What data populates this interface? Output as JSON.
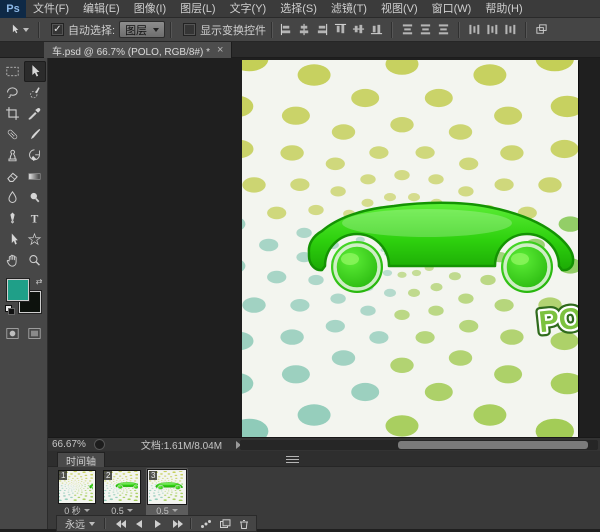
{
  "menu_bar": {
    "logo_text": "Ps",
    "items": [
      "文件(F)",
      "编辑(E)",
      "图像(I)",
      "图层(L)",
      "文字(Y)",
      "选择(S)",
      "滤镜(T)",
      "视图(V)",
      "窗口(W)",
      "帮助(H)"
    ]
  },
  "options_bar": {
    "auto_select_label": "自动选择:",
    "auto_select_value": "图层",
    "show_transform_label": "显示变换控件",
    "checkmark_glyph": "✓",
    "align_buttons": [
      "align-left-edges",
      "align-horizontal-centers",
      "align-right-edges",
      "align-top-edges",
      "align-vertical-centers",
      "align-bottom-edges",
      "distribute-top-edges",
      "distribute-vertical-centers",
      "distribute-bottom-edges",
      "distribute-left-edges",
      "distribute-horizontal-centers",
      "distribute-right-edges",
      "auto-align-layers"
    ]
  },
  "document_tab": {
    "title": "车.psd @ 66.7% (POLO, RGB/8#) *",
    "close_glyph": "×"
  },
  "tools": {
    "selected": "move-tool",
    "items": [
      "rectangular-marquee-tool",
      "move-tool",
      "lasso-tool",
      "quick-selection-tool",
      "crop-tool",
      "eyedropper-tool",
      "spot-healing-brush-tool",
      "brush-tool",
      "clone-stamp-tool",
      "history-brush-tool",
      "eraser-tool",
      "gradient-tool",
      "blur-tool",
      "dodge-tool",
      "pen-tool",
      "type-tool",
      "path-selection-tool",
      "custom-shape-tool",
      "hand-tool",
      "zoom-tool"
    ],
    "bottom_items": [
      "quick-mask-button",
      "screen-mode-button"
    ]
  },
  "color_swatches": {
    "foreground": "#1f9f88",
    "background": "#0d120d"
  },
  "canvas": {
    "po_text": "PO",
    "colors": {
      "paper": "#f3f5ef",
      "dot_olive": "#c3ce55",
      "dot_green": "#7cc548",
      "dot_green2": "#a2cb55",
      "dot_teal": "#8ecab8",
      "car_light": "#5dee37",
      "car_main": "#2ed10e",
      "car_dark": "#1cab05",
      "car_stroke": "#149303",
      "po_fill": "#7cc23f"
    }
  },
  "status_bar": {
    "zoom_level": "66.67%",
    "doc_info": "文档:1.61M/8.04M"
  },
  "timeline": {
    "tab_label": "时间轴",
    "loop_label": "永远",
    "selected_frame_index": 2,
    "frames": [
      {
        "number": "1",
        "duration": "0 秒"
      },
      {
        "number": "2",
        "duration": "0.5"
      },
      {
        "number": "3",
        "duration": "0.5"
      }
    ],
    "buttons": [
      "first-frame-button",
      "previous-frame-button",
      "play-button",
      "next-frame-button",
      "tween-button",
      "duplicate-frame-button",
      "delete-frame-button"
    ]
  }
}
